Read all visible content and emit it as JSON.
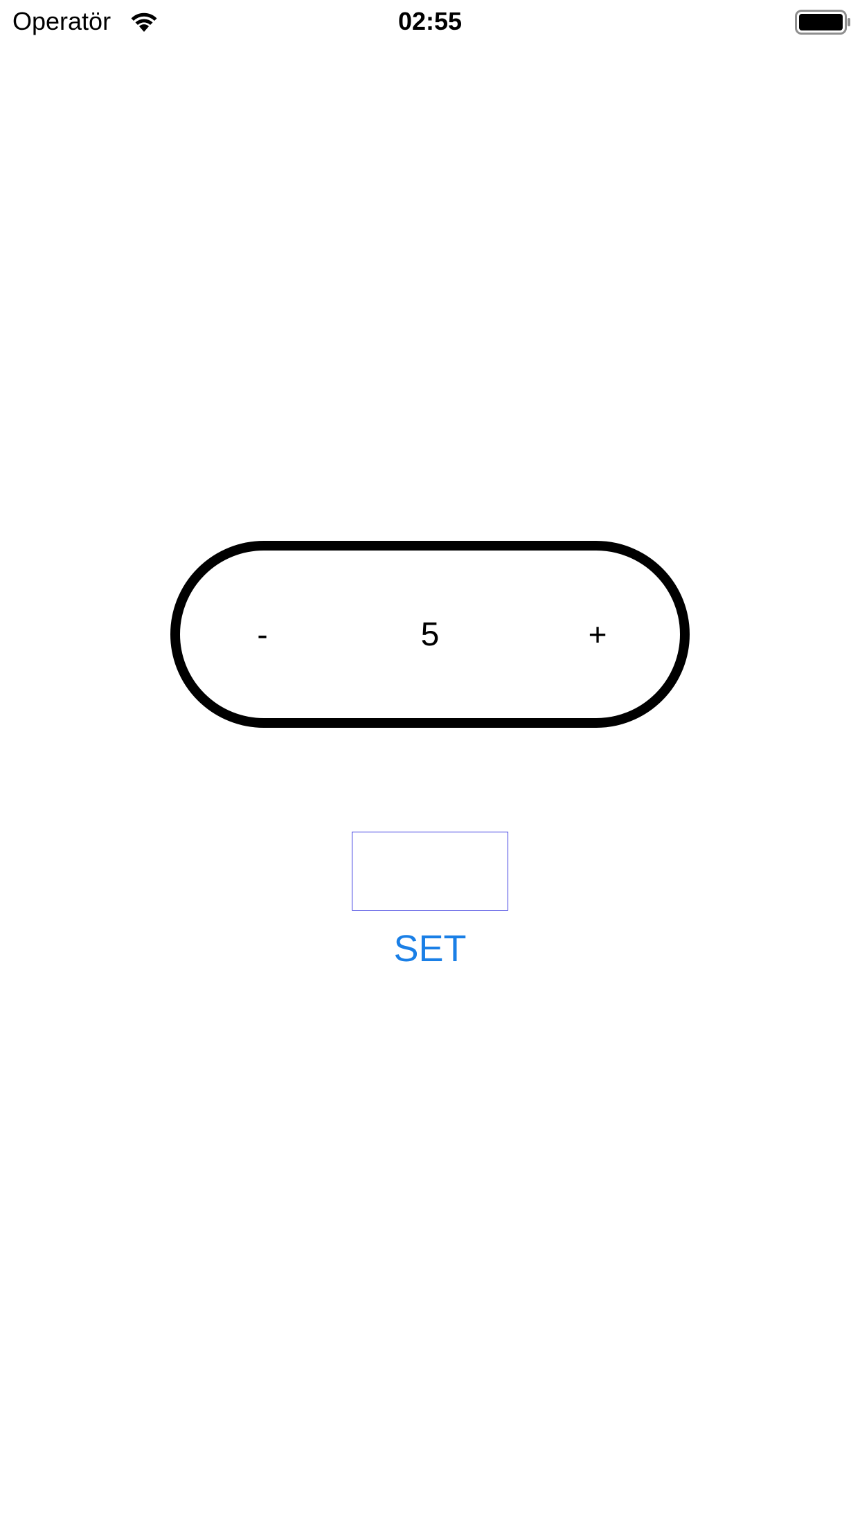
{
  "status_bar": {
    "carrier": "Operatör",
    "time": "02:55",
    "wifi_icon": "wifi-icon",
    "battery_icon": "battery-icon",
    "battery_level": 1.0
  },
  "stepper": {
    "minus_label": "-",
    "value": "5",
    "plus_label": "+"
  },
  "value_field": {
    "value": "",
    "placeholder": ""
  },
  "set_button": {
    "label": "SET"
  },
  "colors": {
    "accent": "#1a7fe6",
    "field_border": "#3a3ae0",
    "stepper_border": "#000000",
    "background": "#ffffff"
  }
}
